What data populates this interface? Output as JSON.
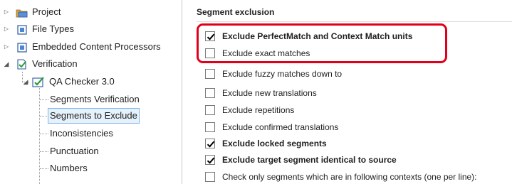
{
  "tree": {
    "items": [
      {
        "label": "Project",
        "icon": "project-folder-icon"
      },
      {
        "label": "File Types",
        "icon": "file-types-icon"
      },
      {
        "label": "Embedded Content Processors",
        "icon": "embedded-content-icon"
      },
      {
        "label": "Verification",
        "icon": "verification-icon"
      },
      {
        "label": "QA Checker 3.0",
        "icon": "qa-checker-icon"
      },
      {
        "label": "Segments Verification"
      },
      {
        "label": "Segments to Exclude"
      },
      {
        "label": "Inconsistencies"
      },
      {
        "label": "Punctuation"
      },
      {
        "label": "Numbers"
      }
    ]
  },
  "panel": {
    "section_title": "Segment exclusion",
    "options": [
      {
        "label": "Exclude PerfectMatch and Context Match units",
        "checked": true,
        "bold": true
      },
      {
        "label": "Exclude exact matches",
        "checked": false,
        "bold": false
      },
      {
        "label": "Exclude fuzzy matches down to",
        "checked": false,
        "bold": false
      },
      {
        "label": "Exclude new translations",
        "checked": false,
        "bold": false
      },
      {
        "label": "Exclude repetitions",
        "checked": false,
        "bold": false
      },
      {
        "label": "Exclude confirmed translations",
        "checked": false,
        "bold": false
      },
      {
        "label": "Exclude locked segments",
        "checked": true,
        "bold": true
      },
      {
        "label": "Exclude target segment identical to source",
        "checked": true,
        "bold": true
      },
      {
        "label": "Check only segments which are in following contexts (one per line):",
        "checked": false,
        "bold": false
      }
    ]
  },
  "colors": {
    "highlight": "#e0001a",
    "selection_bg": "#e5f1fb",
    "selection_border": "#7eb4ea",
    "check_mark": "#000000"
  }
}
